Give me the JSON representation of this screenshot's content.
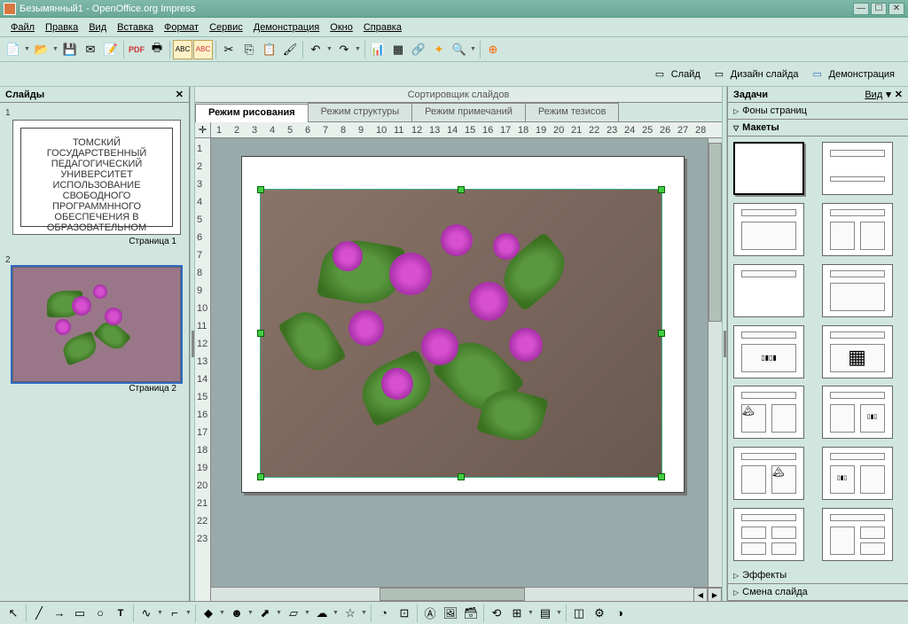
{
  "title": "Безымянный1 - OpenOffice.org Impress",
  "menu": {
    "file": "Файл",
    "edit": "Правка",
    "view": "Вид",
    "insert": "Вставка",
    "format": "Формат",
    "tools": "Сервис",
    "slideshow": "Демонстрация",
    "window": "Окно",
    "help": "Справка"
  },
  "secondbar": {
    "slide": "Слайд",
    "design": "Дизайн слайда",
    "slideshow": "Демонстрация"
  },
  "slides_panel": {
    "title": "Слайды",
    "page1": "Страница 1",
    "page2": "Страница 2",
    "num1": "1",
    "num2": "2"
  },
  "slide1_content": {
    "line1": "ТОМСКИЙ ГОСУДАРСТВЕННЫЙ",
    "line2": "ПЕДАГОГИЧЕСКИЙ УНИВЕРСИТЕТ",
    "line3": "ИСПОЛЬЗОВАНИЕ СВОБОДНОГО",
    "line4": "ПРОГРАММННОГО ОБЕСПЕЧЕНИЯ В",
    "line5": "ОБРАЗОВАТЕЛЬНОМ ПРОЦЕССЕ"
  },
  "sorter": "Сортировщик слайдов",
  "tabs": {
    "draw": "Режим рисования",
    "outline": "Режим структуры",
    "notes": "Режим примечаний",
    "handout": "Режим тезисов"
  },
  "ruler_h": [
    "1",
    "2",
    "3",
    "4",
    "5",
    "6",
    "7",
    "8",
    "9",
    "10",
    "11",
    "12",
    "13",
    "14",
    "15",
    "16",
    "17",
    "18",
    "19",
    "20",
    "21",
    "22",
    "23",
    "24",
    "25",
    "26",
    "27",
    "28"
  ],
  "ruler_v": [
    "1",
    "2",
    "3",
    "4",
    "5",
    "6",
    "7",
    "8",
    "9",
    "10",
    "11",
    "12",
    "13",
    "14",
    "15",
    "16",
    "17",
    "18",
    "19",
    "20",
    "21",
    "22",
    "23"
  ],
  "tasks": {
    "title": "Задачи",
    "view": "Вид",
    "masters": "Фоны страниц",
    "layouts": "Макеты",
    "effects": "Эффекты",
    "transition": "Смена слайда"
  }
}
